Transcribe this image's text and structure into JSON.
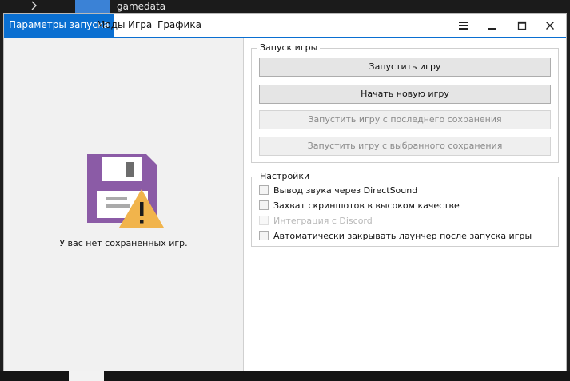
{
  "background": {
    "chevron_icon": "chevron-right-icon",
    "title": "gamedata"
  },
  "tabs": [
    {
      "label": "Параметры запуска",
      "active": true
    },
    {
      "label": "Моды",
      "active": false
    },
    {
      "label": "Игра",
      "active": false
    },
    {
      "label": "Графика",
      "active": false
    }
  ],
  "window_controls": [
    "menu-icon",
    "minimize-icon",
    "maximize-icon",
    "close-icon"
  ],
  "accent_color": "#0a6fd1",
  "left_panel": {
    "icon": "floppy-warning-icon",
    "message": "У вас нет сохранённых игр."
  },
  "launch_group": {
    "title": "Запуск игры",
    "buttons": [
      {
        "label": "Запустить игру",
        "enabled": true
      },
      {
        "label": "Начать новую игру",
        "enabled": true
      },
      {
        "label": "Запустить игру с последнего сохранения",
        "enabled": false
      },
      {
        "label": "Запустить игру с выбранного сохранения",
        "enabled": false
      }
    ]
  },
  "settings_group": {
    "title": "Настройки",
    "options": [
      {
        "label": "Вывод звука через DirectSound",
        "checked": false,
        "enabled": true
      },
      {
        "label": "Захват скриншотов в высоком качестве",
        "checked": false,
        "enabled": true
      },
      {
        "label": "Интеграция с Discord",
        "checked": false,
        "enabled": false
      },
      {
        "label": "Автоматически закрывать лаунчер после запуска игры",
        "checked": false,
        "enabled": true
      }
    ]
  }
}
